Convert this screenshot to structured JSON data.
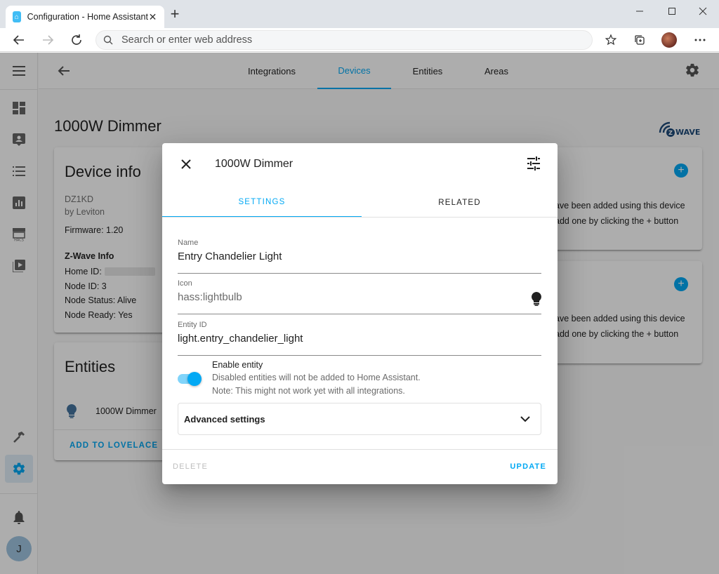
{
  "browser": {
    "tab_title": "Configuration - Home Assistant",
    "address_placeholder": "Search or enter web address"
  },
  "ha": {
    "nav_tabs": [
      {
        "label": "Integrations"
      },
      {
        "label": "Devices"
      },
      {
        "label": "Entities"
      },
      {
        "label": "Areas"
      }
    ],
    "active_tab": "Devices",
    "page_title": "1000W Dimmer",
    "user_initial": "J",
    "device_info": {
      "heading": "Device info",
      "model": "DZ1KD",
      "manufacturer": "by Leviton",
      "firmware": "Firmware: 1.20",
      "zwave_heading": "Z-Wave Info",
      "home_id_label": "Home ID:",
      "node_id": "Node ID: 3",
      "node_status": "Node Status: Alive",
      "node_ready": "Node Ready: Yes"
    },
    "entities_card": {
      "heading": "Entities",
      "entity_name": "1000W Dimmer",
      "add_lovelace": "ADD TO LOVELACE"
    },
    "right_cards": [
      {
        "line1": "ave been added using this device",
        "line2": "add one by clicking the + button"
      },
      {
        "line1": "ave been added using this device",
        "line2": "add one by clicking the + button"
      }
    ],
    "zwave_logo_text": "WAVE"
  },
  "dialog": {
    "title": "1000W Dimmer",
    "tabs": [
      {
        "label": "SETTINGS"
      },
      {
        "label": "RELATED"
      }
    ],
    "active_tab": "SETTINGS",
    "name_label": "Name",
    "name_value": "Entry Chandelier Light",
    "icon_label": "Icon",
    "icon_value": "hass:lightbulb",
    "entity_id_label": "Entity ID",
    "entity_id_value": "light.entry_chandelier_light",
    "enable_entity": {
      "title": "Enable entity",
      "line1": "Disabled entities will not be added to Home Assistant.",
      "line2": "Note: This might not work yet with all integrations.",
      "enabled": true
    },
    "advanced_settings": "Advanced settings",
    "delete_label": "DELETE",
    "update_label": "UPDATE"
  },
  "colors": {
    "accent": "#03a9f4",
    "scrim": "rgba(0,0,0,0.32)"
  }
}
